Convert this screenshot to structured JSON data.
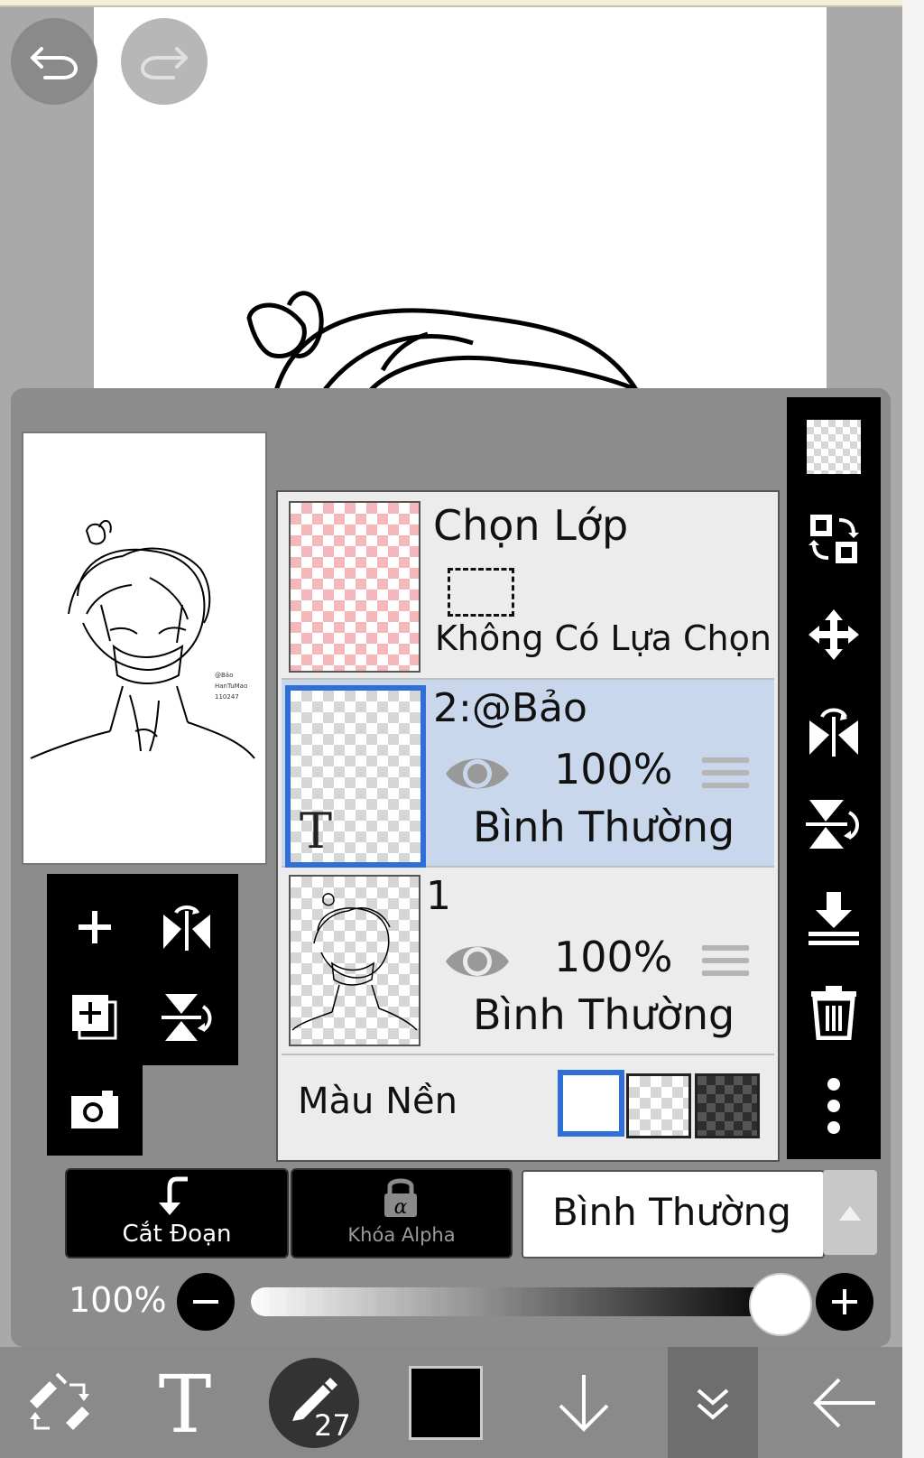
{
  "layer_panel": {
    "selection_layer": {
      "title": "Chọn Lớp",
      "subtitle": "Không Có Lựa Chọn"
    },
    "layers": [
      {
        "name": "2:@Bảo",
        "opacity": "100%",
        "blend": "Bình Thường",
        "selected": true
      },
      {
        "name": "1",
        "opacity": "100%",
        "blend": "Bình Thường",
        "selected": false
      }
    ],
    "background": {
      "label": "Màu Nền",
      "options": [
        "white",
        "transparent",
        "dark"
      ],
      "selected": "white"
    }
  },
  "thumbnail": {
    "caption_lines": [
      "@Bảo",
      "HanTuMao",
      "110247"
    ]
  },
  "buttons": {
    "clip": "Cắt Đoạn",
    "alpha_lock": "Khóa Alpha",
    "blend_mode": "Bình Thường"
  },
  "opacity": {
    "value_label": "100%",
    "value": 1.0
  },
  "bottom_toolbar": {
    "brush_size": "27"
  },
  "colors": {
    "selected_row": "#c9d7ec",
    "selection_border": "#2f6fd6",
    "foreground_color": "#000000"
  }
}
